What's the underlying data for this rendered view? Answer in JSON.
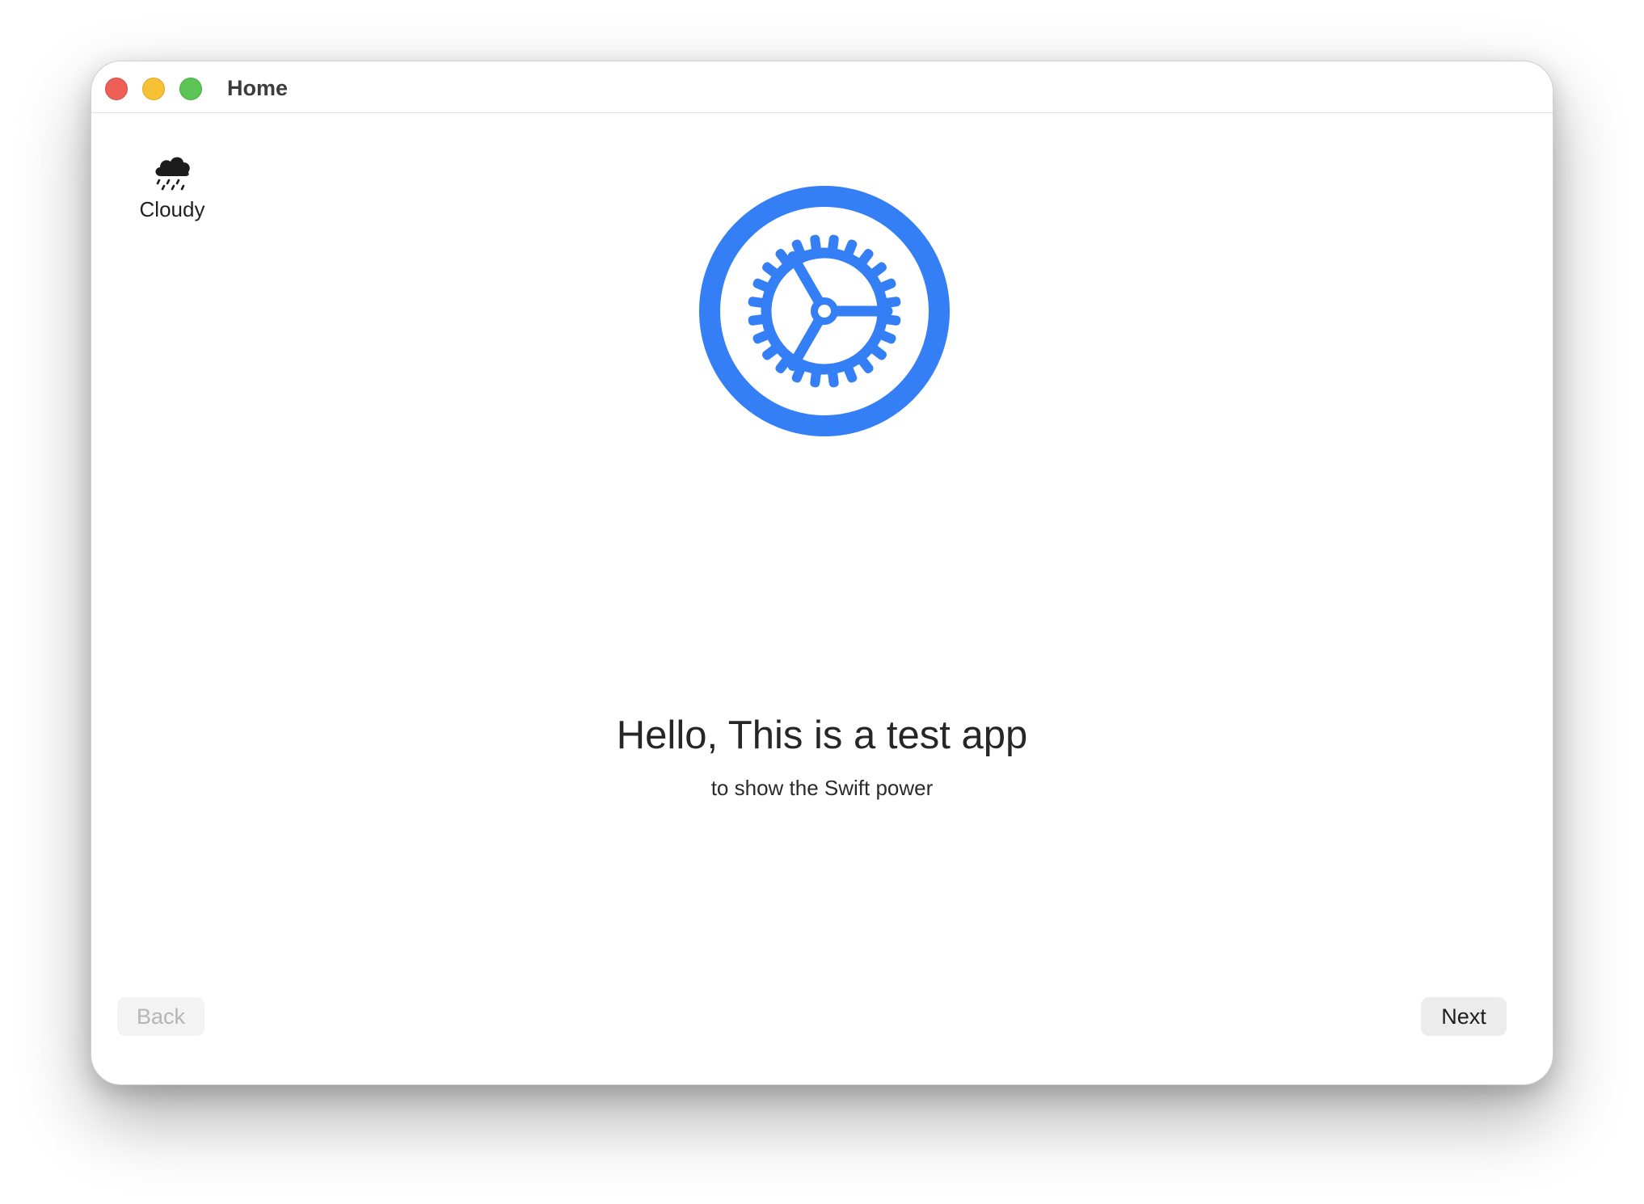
{
  "window": {
    "title": "Home"
  },
  "weather": {
    "icon": "cloud-drizzle-icon",
    "label": "Cloudy"
  },
  "hero": {
    "icon": "gear-icon",
    "color": "#347ef6"
  },
  "content": {
    "headline": "Hello, This is a test app",
    "subline": "to show the Swift power"
  },
  "navigation": {
    "back_label": "Back",
    "back_enabled": false,
    "next_label": "Next"
  }
}
